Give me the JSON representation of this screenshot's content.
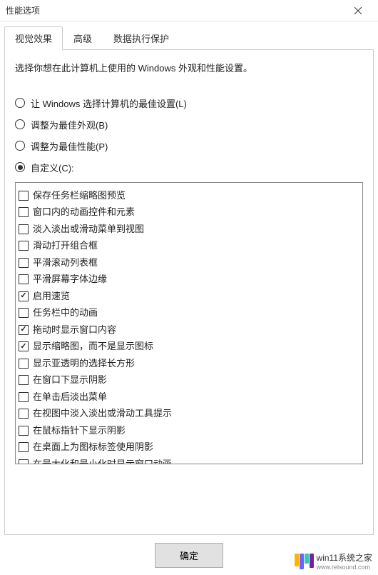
{
  "window": {
    "title": "性能选项"
  },
  "tabs": [
    {
      "label": "视觉效果",
      "active": true
    },
    {
      "label": "高级",
      "active": false
    },
    {
      "label": "数据执行保护",
      "active": false
    }
  ],
  "description": "选择你想在此计算机上使用的 Windows 外观和性能设置。",
  "radios": [
    {
      "label": "让 Windows 选择计算机的最佳设置(L)",
      "selected": false
    },
    {
      "label": "调整为最佳外观(B)",
      "selected": false
    },
    {
      "label": "调整为最佳性能(P)",
      "selected": false
    },
    {
      "label": "自定义(C):",
      "selected": true
    }
  ],
  "checklist": [
    {
      "label": "保存任务栏缩略图预览",
      "checked": false
    },
    {
      "label": "窗口内的动画控件和元素",
      "checked": false
    },
    {
      "label": "淡入淡出或滑动菜单到视图",
      "checked": false
    },
    {
      "label": "滑动打开组合框",
      "checked": false
    },
    {
      "label": "平滑滚动列表框",
      "checked": false
    },
    {
      "label": "平滑屏幕字体边缘",
      "checked": false
    },
    {
      "label": "启用速览",
      "checked": true
    },
    {
      "label": "任务栏中的动画",
      "checked": false
    },
    {
      "label": "拖动时显示窗口内容",
      "checked": true
    },
    {
      "label": "显示缩略图，而不是显示图标",
      "checked": true
    },
    {
      "label": "显示亚透明的选择长方形",
      "checked": false
    },
    {
      "label": "在窗口下显示阴影",
      "checked": false
    },
    {
      "label": "在单击后淡出菜单",
      "checked": false
    },
    {
      "label": "在视图中淡入淡出或滑动工具提示",
      "checked": false
    },
    {
      "label": "在鼠标指针下显示阴影",
      "checked": false
    },
    {
      "label": "在桌面上为图标标签使用阴影",
      "checked": false
    },
    {
      "label": "在最大化和最小化时显示窗口动画",
      "checked": false
    }
  ],
  "buttons": {
    "ok": "确定"
  },
  "watermark": {
    "text": "win11系统之家",
    "url": "www.relsound.com"
  }
}
